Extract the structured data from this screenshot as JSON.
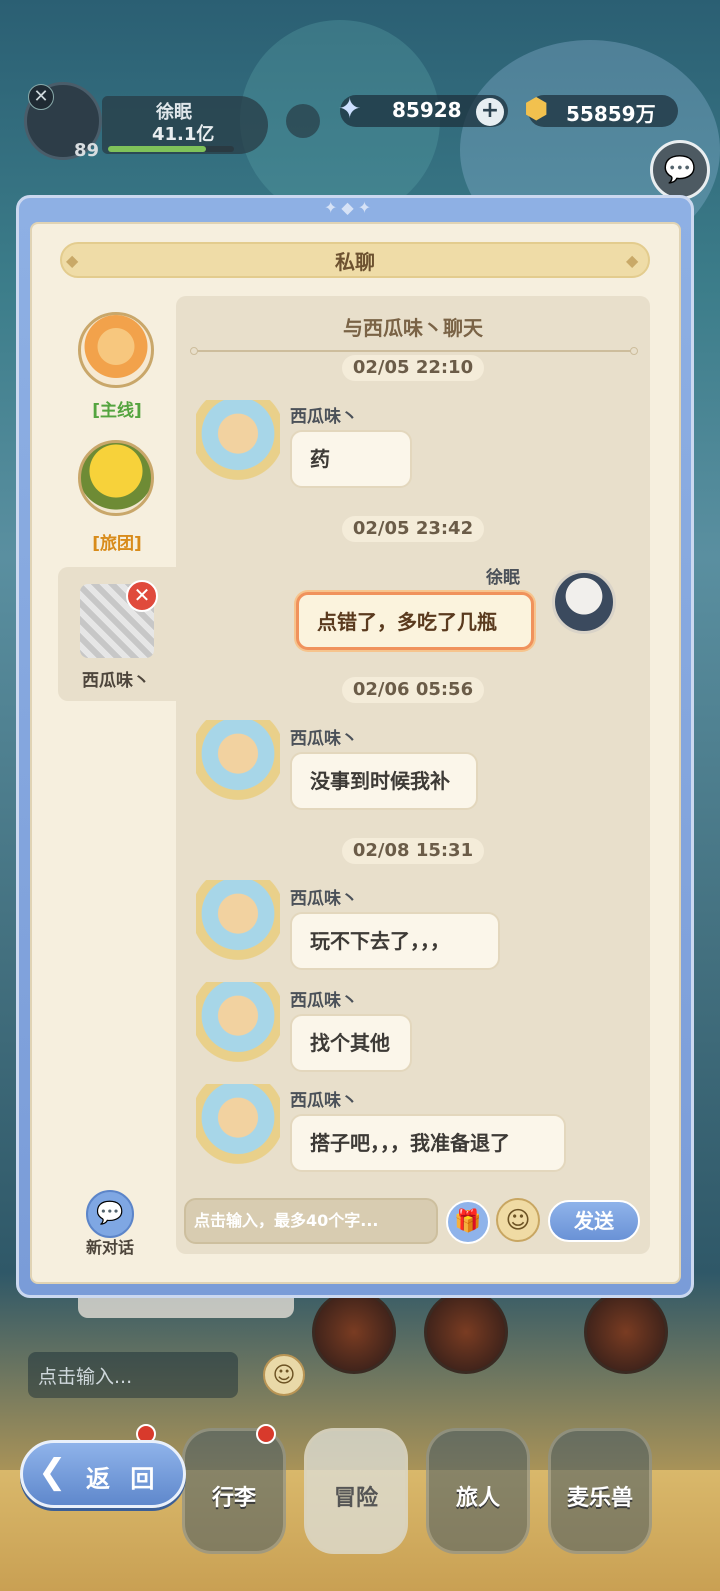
{
  "colors": {
    "accent_blue": "#7a9cd8",
    "panel_bg": "#f6efde",
    "chat_bg": "#e8dfcb",
    "close_red": "#e04a3c"
  },
  "player": {
    "name": "徐眠",
    "power": "41.1亿",
    "level": "89"
  },
  "currency": {
    "stars": "85928",
    "gold": "55859万",
    "plus": "+"
  },
  "modal": {
    "title": "私聊",
    "ornament": "✦◆✦"
  },
  "sidebar": {
    "items": [
      {
        "label": "[主线]",
        "icon": "fox-mascot-icon"
      },
      {
        "label": "[旅团]",
        "icon": "golden-tree-icon"
      },
      {
        "label": "西瓜味丶",
        "icon": "chibi-avatar-icon",
        "close": "✕"
      }
    ],
    "new_chat": {
      "label": "新对话",
      "icon": "new-chat-icon"
    }
  },
  "chat": {
    "title": "与西瓜味丶聊天",
    "timestamps": [
      "02/05 22:10",
      "02/05 23:42",
      "02/06 05:56",
      "02/08 15:31"
    ],
    "messages": [
      {
        "sender": "西瓜味丶",
        "text": "药"
      },
      {
        "sender": "徐眠",
        "text": "点错了，多吃了几瓶",
        "self": true
      },
      {
        "sender": "西瓜味丶",
        "text": "没事到时候我补"
      },
      {
        "sender": "西瓜味丶",
        "text": "玩不下去了，，，"
      },
      {
        "sender": "西瓜味丶",
        "text": "找个其他"
      },
      {
        "sender": "西瓜味丶",
        "text": "搭子吧，，，我准备退了"
      }
    ]
  },
  "composer": {
    "placeholder": "点击输入，最多40个字...",
    "send": "发送"
  },
  "background": {
    "input_placeholder": "点击输入..."
  },
  "nav": {
    "back": "返 回",
    "items": [
      "行李",
      "冒险",
      "旅人",
      "麦乐兽"
    ]
  }
}
